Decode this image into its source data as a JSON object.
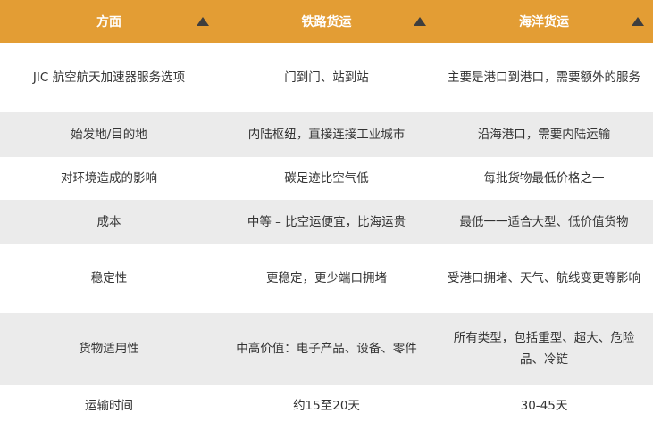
{
  "header": {
    "col1": "方面",
    "col2": "铁路货运",
    "col3": "海洋货运"
  },
  "colors": {
    "header_bg": "#e39d34",
    "header_text": "#ffffff",
    "row_stripe": "#ebebeb",
    "row_plain": "#ffffff",
    "sort_icon": "#3e3e3e"
  },
  "icons": {
    "sort": "sort-ascending-triangle-icon"
  },
  "rows": [
    {
      "aspect": "JIC 航空航天加速器服务选项",
      "rail": "门到门、站到站",
      "ocean": "主要是港口到港口，需要额外的服务"
    },
    {
      "aspect": "始发地/目的地",
      "rail": "内陆枢纽，直接连接工业城市",
      "ocean": "沿海港口，需要内陆运输"
    },
    {
      "aspect": "对环境造成的影响",
      "rail": "碳足迹比空气低",
      "ocean": "每批货物最低价格之一"
    },
    {
      "aspect": "成本",
      "rail": "中等 – 比空运便宜，比海运贵",
      "ocean": "最低一一适合大型、低价值货物"
    },
    {
      "aspect": "稳定性",
      "rail": "更稳定，更少端口拥堵",
      "ocean": "受港口拥堵、天气、航线变更等影响"
    },
    {
      "aspect": "货物适用性",
      "rail": "中高价值：电子产品、设备、零件",
      "ocean": "所有类型，包括重型、超大、危险品、冷链"
    },
    {
      "aspect": "运输时间",
      "rail": "约15至20天",
      "ocean": "30-45天"
    }
  ]
}
